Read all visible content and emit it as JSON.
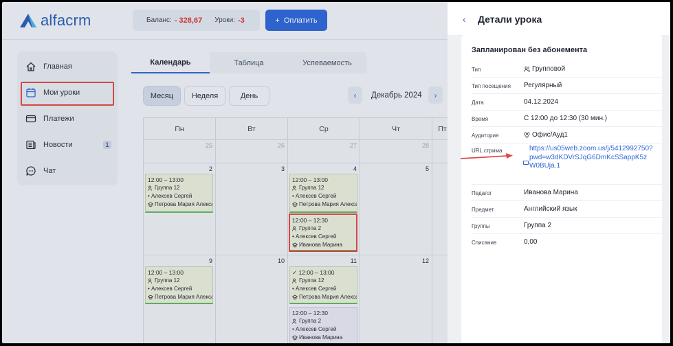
{
  "brand": {
    "logo_text": "alfacrm"
  },
  "header": {
    "balance_label": "Баланс:",
    "balance_value": "- 328,67",
    "lessons_label": "Уроки:",
    "lessons_value": "-3",
    "pay_label": "Оплатить"
  },
  "sidebar": {
    "items": [
      {
        "label": "Главная",
        "icon": "home-icon"
      },
      {
        "label": "Мои уроки",
        "icon": "calendar-icon"
      },
      {
        "label": "Платежи",
        "icon": "card-icon"
      },
      {
        "label": "Новости",
        "icon": "news-icon",
        "badge": "1"
      },
      {
        "label": "Чат",
        "icon": "chat-icon"
      }
    ]
  },
  "tabs": [
    "Календарь",
    "Таблица",
    "Успеваемость"
  ],
  "view_buttons": [
    "Месяц",
    "Неделя",
    "День"
  ],
  "month_label": "Декабрь 2024",
  "calendar": {
    "weekdays": [
      "Пн",
      "Вт",
      "Ср",
      "Чт",
      "Пт"
    ],
    "week1": [
      "25",
      "26",
      "27",
      "28",
      ""
    ],
    "week2": [
      "2",
      "3",
      "4",
      "5",
      ""
    ],
    "week3": [
      "9",
      "10",
      "11",
      "12",
      ""
    ],
    "lessons": [
      {
        "time": "12:00 – 13:00",
        "group": "Группа 12",
        "student": "• Алексев Сергей",
        "teacher": "Петрова Мария Алекса"
      },
      {
        "time": "12:00 – 13:00",
        "group": "Группа 12",
        "student": "• Алексев Сергей",
        "teacher": "Петрова Мария Алекса"
      },
      {
        "time": "12:00 – 12:30",
        "group": "Группа 2",
        "student": "• Алексев Сергей",
        "teacher": "Иванова Марина"
      },
      {
        "time": "12:00 – 13:00",
        "group": "Группа 12",
        "student": "• Алексев Сергей",
        "teacher": "Петрова Мария Алекса"
      },
      {
        "time": "12:00 – 13:00",
        "group": "Группа 12",
        "student": "• Алексев Сергей",
        "teacher": "Петрова Мария Алекса"
      },
      {
        "time": "12:00 – 12:30",
        "group": "Группа 2",
        "student": "• Алексев Сергей",
        "teacher": "Иванова Марина"
      }
    ]
  },
  "panel": {
    "title": "Детали урока",
    "card_title": "Запланирован без абонемента",
    "rows": [
      {
        "label": "Тип",
        "value": "Групповой"
      },
      {
        "label": "Тип посещения",
        "value": "Регулярный"
      },
      {
        "label": "Дата",
        "value": "04.12.2024"
      },
      {
        "label": "Время",
        "value": "С 12:00 до 12:30 (30 мин.)"
      },
      {
        "label": "Аудитория",
        "value": "Офис/Ауд1"
      },
      {
        "label": "URL стрима",
        "value": "https://us05web.zoom.us/j/5412992750?pwd=w3dKDVrSJqG6DmKcSSappK5zW0BUja.1"
      },
      {
        "label": "Педагог",
        "value": "Иванова Марина"
      },
      {
        "label": "Предмет",
        "value": "Английский язык"
      },
      {
        "label": "Группы",
        "value": "Группа 2"
      },
      {
        "label": "Списание",
        "value": "0,00"
      }
    ]
  },
  "colors": {
    "accent": "#2f67d6",
    "negative": "#d93636",
    "highlight": "#e04848",
    "lesson_green": "#5db85d",
    "lesson_purple": "#6b35c9"
  }
}
